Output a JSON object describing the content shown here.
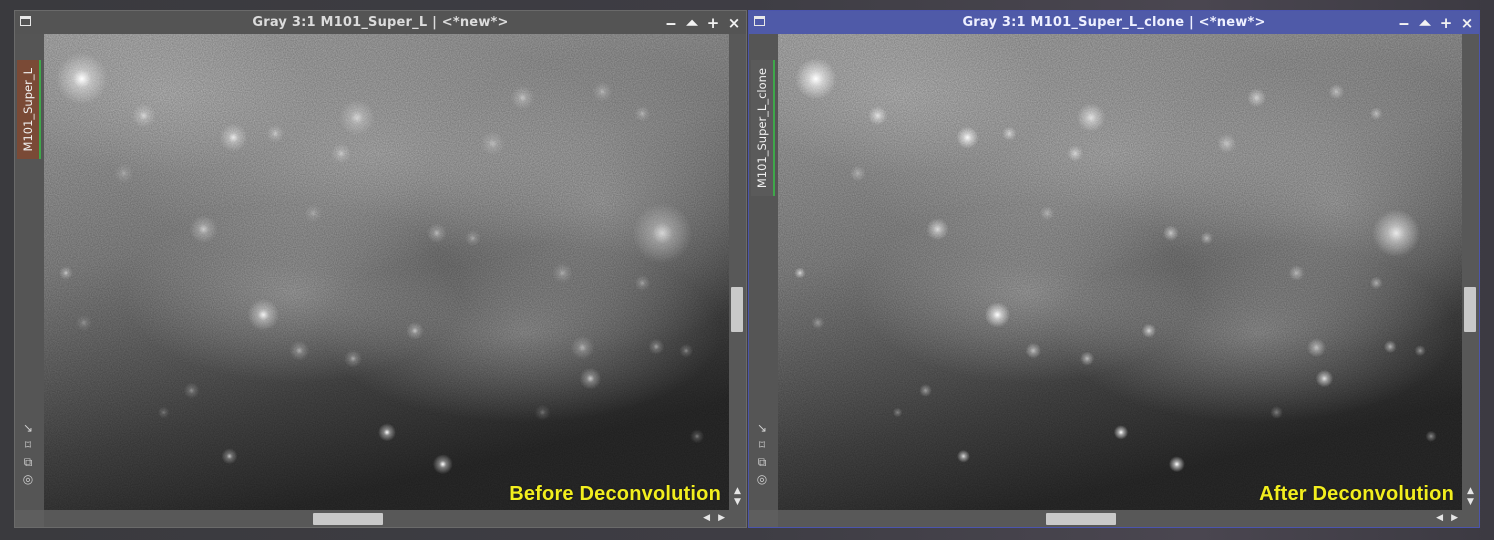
{
  "windows": [
    {
      "title": "Gray 3:1 M101_Super_L | <*new*>",
      "view_tab": "M101_Super_L",
      "caption": "Before Deconvolution",
      "buttons": {
        "minimize": "‒",
        "shade": "⏶",
        "maximize": "+",
        "close": "×"
      },
      "tools": [
        "↘",
        "⌑",
        "⧉",
        "◎"
      ]
    },
    {
      "title": "Gray 3:1 M101_Super_L_clone | <*new*>",
      "view_tab": "M101_Super_L_clone",
      "caption": "After Deconvolution",
      "buttons": {
        "minimize": "‒",
        "shade": "⏶",
        "maximize": "+",
        "close": "×"
      },
      "tools": [
        "↘",
        "⌑",
        "⧉",
        "◎"
      ]
    }
  ],
  "scroll_arrows": {
    "up": "▲",
    "down": "▼",
    "left": "◀",
    "right": "▶"
  },
  "colors": {
    "caption": "#f2ee1e",
    "active_title": "#4f5aa8",
    "view_tab_active": "#7a4a36",
    "tab_marker": "#3ea84a"
  }
}
